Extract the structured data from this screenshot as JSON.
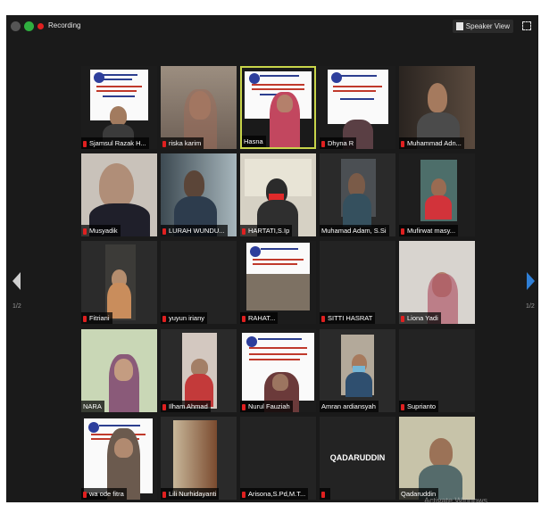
{
  "topbar": {
    "recording_label": "Recording",
    "speaker_view_label": "Speaker View"
  },
  "pagination": {
    "left": "1/2",
    "right": "1/2"
  },
  "participants": [
    {
      "name": "Sjamsul Razak H..."
    },
    {
      "name": "riska karim"
    },
    {
      "name": "Hasna"
    },
    {
      "name": "Dhyna R"
    },
    {
      "name": "Muhammad Adn..."
    },
    {
      "name": "Musyadik"
    },
    {
      "name": "LURAH WUNDU..."
    },
    {
      "name": "HARTATI,S.Ip"
    },
    {
      "name": "Muhamad Adam, S.Si"
    },
    {
      "name": "Mufirwat masy..."
    },
    {
      "name": "Fitriani"
    },
    {
      "name": "yuyun iriany"
    },
    {
      "name": "RAHAT..."
    },
    {
      "name": "SITTI HASRAT"
    },
    {
      "name": "Liona Yadi"
    },
    {
      "name": "NARA"
    },
    {
      "name": "Ilham Ahmad"
    },
    {
      "name": "Nurul Fauziah"
    },
    {
      "name": "Amran ardiansyah"
    },
    {
      "name": "Suprianto"
    },
    {
      "name": "wa ode fitra"
    },
    {
      "name": "Lili Nurhidayanti"
    },
    {
      "name": "Arisona,S.Pd,M.T..."
    },
    {
      "name": "",
      "center_label": "QADARUDDIN"
    },
    {
      "name": "Qadaruddin"
    }
  ],
  "watermark": "Activate Windows",
  "colors": {
    "active_speaker": "#c8d44a",
    "mic_muted": "#e02020",
    "arrow_right": "#2f7fd6"
  }
}
